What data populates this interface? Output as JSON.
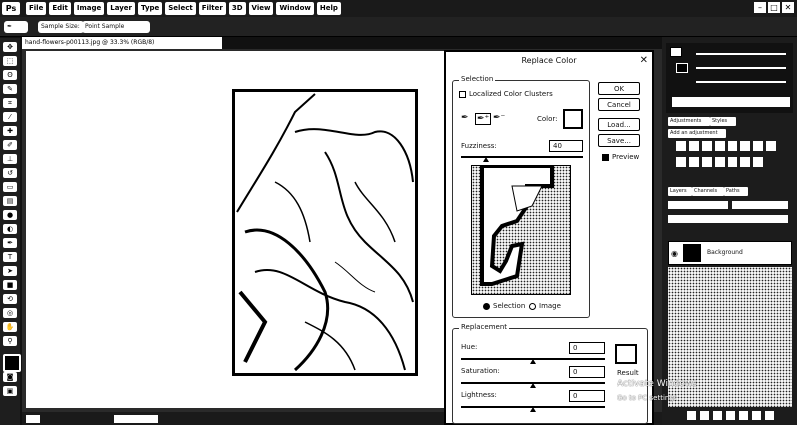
{
  "menubar": {
    "logo": "Ps",
    "items": [
      "File",
      "Edit",
      "Image",
      "Layer",
      "Type",
      "Select",
      "Filter",
      "3D",
      "View",
      "Window",
      "Help"
    ],
    "window_controls": [
      "–",
      "□",
      "✕"
    ]
  },
  "options_bar": {
    "preset_label": "Sample Size:",
    "preset_value": "Point Sample"
  },
  "document": {
    "tab_title": "hand-flowers-p00113.jpg @ 33.3% (RGB/8)"
  },
  "dialog": {
    "title": "Replace Color",
    "close": "✕",
    "selection": {
      "label": "Selection",
      "localized_label": "Localized Color Clusters",
      "localized_checked": false,
      "color_label": "Color:",
      "fuzziness_label": "Fuzziness:",
      "fuzziness_value": "40",
      "radio_selection": "Selection",
      "radio_image": "Image",
      "selected_radio": "Selection"
    },
    "buttons": {
      "ok": "OK",
      "cancel": "Cancel",
      "load": "Load...",
      "save": "Save..."
    },
    "preview_label": "Preview",
    "preview_checked": true,
    "replacement": {
      "label": "Replacement",
      "hue_label": "Hue:",
      "hue_value": "0",
      "saturation_label": "Saturation:",
      "saturation_value": "0",
      "lightness_label": "Lightness:",
      "lightness_value": "0",
      "result_label": "Result"
    }
  },
  "watermark": {
    "line1": "Activate Windows",
    "line2": "Go to PC settings to activate Windows."
  },
  "panels": {
    "adjustments_tab": "Adjustments",
    "styles_tab": "Styles",
    "add_adjustment": "Add an adjustment",
    "layers_tab": "Layers",
    "channels_tab": "Channels",
    "paths_tab": "Paths",
    "layer_name": "Background"
  }
}
